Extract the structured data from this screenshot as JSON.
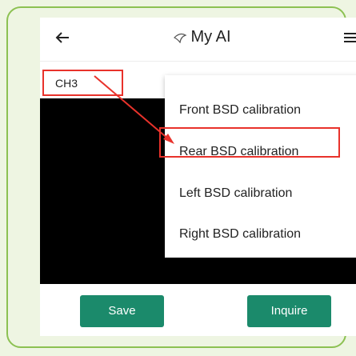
{
  "header": {
    "title": "My AI"
  },
  "channel": {
    "label": "CH3"
  },
  "dropdown": {
    "items": [
      {
        "label": "Front BSD calibration"
      },
      {
        "label": "Rear BSD calibration"
      },
      {
        "label": "Left BSD calibration"
      },
      {
        "label": "Right BSD calibration"
      }
    ],
    "highlighted_item": "Rear BSD calibration"
  },
  "actions": {
    "save_label": "Save",
    "inquire_label": "Inquire"
  },
  "icons": {
    "back": "arrow-left-icon",
    "logo": "logo-icon",
    "menu": "hamburger-menu-icon"
  },
  "colors": {
    "accent_button": "#1b8a6b",
    "annotation_red": "#e8322b",
    "frame_border": "#8cc152",
    "frame_background": "#eef5e2",
    "video_background": "#000000"
  }
}
